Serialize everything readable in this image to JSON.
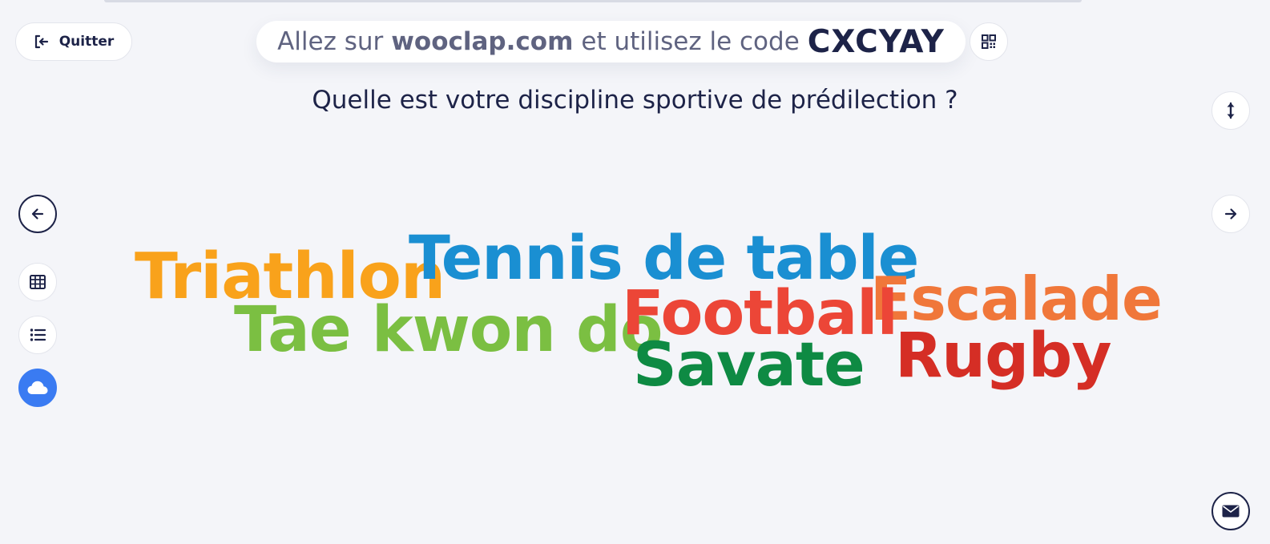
{
  "header": {
    "quit_label": "Quitter",
    "join_prefix": "Allez sur",
    "join_url": "wooclap.com",
    "join_middle": "et utilisez le code",
    "event_code": "CXCYAY"
  },
  "question": "Quelle est votre discipline sportive de prédilection ?",
  "word_cloud": [
    {
      "text": "Triathlon",
      "color": "#f9a21b"
    },
    {
      "text": "Tennis de table",
      "color": "#1a8fd2"
    },
    {
      "text": "Escalade",
      "color": "#f0773a"
    },
    {
      "text": "Tae kwon do",
      "color": "#7bbf42"
    },
    {
      "text": "Football",
      "color": "#ec4637"
    },
    {
      "text": "Savate",
      "color": "#0e8a43"
    },
    {
      "text": "Rugby",
      "color": "#d52e25"
    }
  ],
  "colors": {
    "background": "#f4f5f9",
    "text_dark": "#1d2348",
    "accent_blue": "#3a7bf2"
  },
  "icons": {
    "quit": "exit-door-icon",
    "qr": "qr-code-icon",
    "fullscreen": "vertical-resize-icon",
    "previous": "arrow-left-icon",
    "next": "arrow-right-icon",
    "table_view": "grid-table-icon",
    "list_view": "bulleted-list-icon",
    "cloud_view": "cloud-icon",
    "message": "envelope-icon"
  }
}
